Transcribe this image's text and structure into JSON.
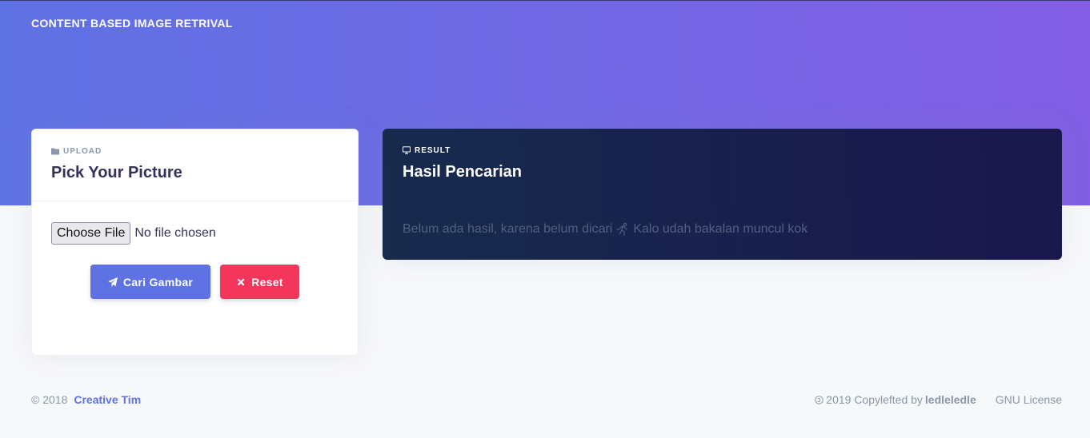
{
  "header": {
    "brand": "CONTENT BASED IMAGE RETRIVAL"
  },
  "upload_card": {
    "overline": "UPLOAD",
    "overline_icon": "folder-icon",
    "title": "Pick Your Picture",
    "file_button_label": "Choose File",
    "file_status": "No file chosen",
    "search_button_label": "Cari Gambar",
    "search_button_icon": "paper-plane-icon",
    "reset_button_label": "Reset",
    "reset_button_icon": "close-icon"
  },
  "result_card": {
    "overline": "RESULT",
    "overline_icon": "monitor-icon",
    "title": "Hasil Pencarian",
    "message_part1": "Belum ada hasil, karena belum dicari",
    "message_icon": "running-icon",
    "message_part2": "Kalo udah bakalan muncul kok"
  },
  "footer": {
    "copyright": "© 2018",
    "link": "Creative Tim",
    "copyleft_text": "2019 Copylefted by",
    "author": "ledleledle",
    "license": "GNU License"
  },
  "colors": {
    "primary": "#5e72e4",
    "danger": "#f5365c",
    "hero_start": "#5e72e4",
    "hero_end": "#825ee4",
    "dark_card": "#172b4d"
  }
}
